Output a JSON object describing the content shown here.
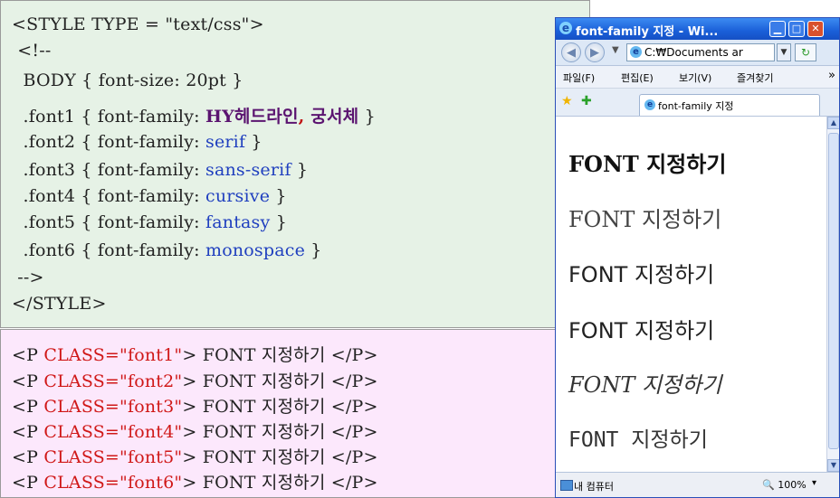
{
  "style_code": {
    "line1": "<STYLE TYPE = \"text/css\">",
    "line2": " <!--",
    "line3": "  BODY { font-size: 20pt }",
    "font1_prefix": "  .font1 { font-family: ",
    "font1_name_a": "HY헤드라인",
    "font1_comma": ",",
    "font1_name_b": " 궁서체",
    "font1_suffix": " }",
    "font2_prefix": "  .font2 { font-family: ",
    "font2_value": "serif",
    "font2_suffix": " }",
    "font3_prefix": "  .font3 { font-family: ",
    "font3_value": "sans-serif",
    "font3_suffix": " }",
    "font4_prefix": "  .font4 { font-family: ",
    "font4_value": "cursive",
    "font4_suffix": " }",
    "font5_prefix": "  .font5 { font-family: ",
    "font5_value": "fantasy",
    "font5_suffix": " }",
    "font6_prefix": "  .font6 { font-family: ",
    "font6_value": "monospace",
    "font6_suffix": " }",
    "end_comment": " -->",
    "close_tag": "</STYLE>"
  },
  "p_code": [
    {
      "open": "<P ",
      "cls": "CLASS=\"font1\"",
      "rest": "> FONT 지정하기 </P>"
    },
    {
      "open": "<P ",
      "cls": "CLASS=\"font2\"",
      "rest": "> FONT 지정하기 </P>"
    },
    {
      "open": "<P ",
      "cls": "CLASS=\"font3\"",
      "rest": "> FONT 지정하기 </P>"
    },
    {
      "open": "<P ",
      "cls": "CLASS=\"font4\"",
      "rest": "> FONT 지정하기 </P>"
    },
    {
      "open": "<P ",
      "cls": "CLASS=\"font5\"",
      "rest": "> FONT 지정하기 </P>"
    },
    {
      "open": "<P ",
      "cls": "CLASS=\"font6\"",
      "rest": "> FONT 지정하기 </P>"
    }
  ],
  "browser": {
    "title": "font-family 지정 - Wi...",
    "address": "C:₩Documents ar",
    "menu": [
      "파일(F)",
      "편집(E)",
      "보기(V)",
      "즐겨찾기"
    ],
    "menu_more": "»",
    "tab_title": "font-family 지정",
    "demo_lines": [
      "FONT 지정하기",
      "FONT 지정하기",
      "FONT 지정하기",
      "FONT 지정하기",
      "FONT 지정하기",
      "FONT 지정하기"
    ],
    "status_text": "내 컴퓨터",
    "zoom": "100%",
    "icons": {
      "back": "back-arrow-icon",
      "forward": "forward-arrow-icon",
      "refresh": "refresh-icon",
      "favorites": "favorites-star-icon",
      "add_favorites": "add-favorites-icon"
    }
  }
}
